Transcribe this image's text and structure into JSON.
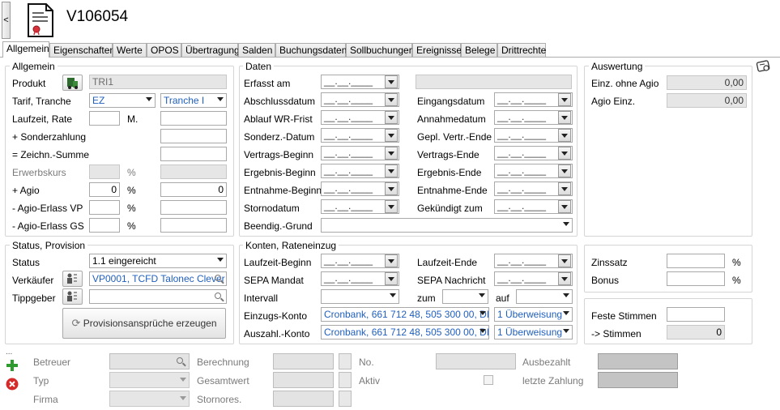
{
  "header": {
    "title": "V106054",
    "collapse_glyph": "<"
  },
  "tabs": [
    {
      "label": "Allgemein"
    },
    {
      "label": "Eigenschaften"
    },
    {
      "label": "Werte"
    },
    {
      "label": "OPOS"
    },
    {
      "label": "Übertragung"
    },
    {
      "label": "Salden"
    },
    {
      "label": "Buchungsdaten"
    },
    {
      "label": "Sollbuchungen"
    },
    {
      "label": "Ereignisse"
    },
    {
      "label": "Belege"
    },
    {
      "label": "Drittrechte"
    }
  ],
  "allgemein": {
    "title": "Allgemein",
    "produkt_label": "Produkt",
    "produkt_value": "TRI1",
    "tarif_label": "Tarif, Tranche",
    "tarif_value": "EZ",
    "tranche_value": "Tranche I",
    "laufzeit_label": "Laufzeit, Rate",
    "laufzeit_unit": "M.",
    "sonder_label": "+ Sonderzahlung",
    "zeichn_label": "= Zeichn.-Summe",
    "erwerbskurs_label": "Erwerbskurs",
    "erwerbskurs_unit": "%",
    "agio_label": "+ Agio",
    "agio_pct": "0",
    "agio_unit": "%",
    "agio_amount": "0",
    "erlass_vp_label": "- Agio-Erlass VP",
    "erlass_vp_unit": "%",
    "erlass_gs_label": "- Agio-Erlass GS",
    "erlass_gs_unit": "%"
  },
  "daten": {
    "title": "Daten",
    "date_placeholder": "__.__.____",
    "left": [
      "Erfasst am",
      "Abschlussdatum",
      "Ablauf WR-Frist",
      "Sonderz.-Datum",
      "Vertrags-Beginn",
      "Ergebnis-Beginn",
      "Entnahme-Beginn",
      "Stornodatum"
    ],
    "right": [
      "Eingangsdatum",
      "Annahmedatum",
      "Gepl. Vertr.-Ende",
      "Vertrags-Ende",
      "Ergebnis-Ende",
      "Entnahme-Ende",
      "Gekündigt zum"
    ],
    "beendig_label": "Beendig.-Grund"
  },
  "auswertung": {
    "title": "Auswertung",
    "einz_label": "Einz. ohne Agio",
    "einz_value": "0,00",
    "agio_einz_label": "Agio Einz.",
    "agio_einz_value": "0,00"
  },
  "status": {
    "title": "Status, Provision",
    "status_label": "Status",
    "status_value": "1.1 eingereicht",
    "verkaeufer_label": "Verkäufer",
    "verkaeufer_value": "VP0001, TCFD Talonec Clever",
    "tippgeber_label": "Tippgeber",
    "prov_button": "Provisionsansprüche erzeugen"
  },
  "konten": {
    "title": "Konten, Rateneinzug",
    "laufzeit_beginn_label": "Laufzeit-Beginn",
    "laufzeit_ende_label": "Laufzeit-Ende",
    "sepa_mandat_label": "SEPA Mandat",
    "sepa_nachricht_label": "SEPA Nachricht",
    "intervall_label": "Intervall",
    "zum_label": "zum",
    "auf_label": "auf",
    "einzugs_label": "Einzugs-Konto",
    "einzugs_value": "Cronbank, 661 712 48, 505 300 00, DE",
    "einzugs_mode": "1 Überweisung",
    "auszahl_label": "Auszahl.-Konto",
    "auszahl_value": "Cronbank, 661 712 48, 505 300 00, DE",
    "auszahl_mode": "1 Überweisung"
  },
  "zins": {
    "zinssatz_label": "Zinssatz",
    "zinssatz_unit": "%",
    "bonus_label": "Bonus",
    "bonus_unit": "%"
  },
  "stimmen": {
    "feste_label": "Feste Stimmen",
    "stimmen_label": "-> Stimmen",
    "stimmen_value": "0"
  },
  "bottom": {
    "dots": "...",
    "betreuer_label": "Betreuer",
    "typ_label": "Typ",
    "firma_label": "Firma",
    "berechnung_label": "Berechnung",
    "gesamtwert_label": "Gesamtwert",
    "stornores_label": "Stornores.",
    "no_label": "No.",
    "aktiv_label": "Aktiv",
    "ausbezahlt_label": "Ausbezahlt",
    "letzte_zahlung_label": "letzte Zahlung"
  },
  "colors": {
    "link_blue": "#1f5fbf",
    "green_plus": "#2e9b2e",
    "red_x": "#d42a2a"
  }
}
